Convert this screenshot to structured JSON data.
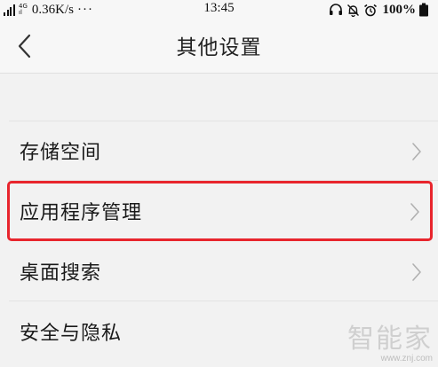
{
  "status_bar": {
    "network_type": "4G",
    "net_badge_bottom": "ıl",
    "speed": "0.36K/s",
    "more": "···",
    "time": "13:45",
    "battery": "100%",
    "icons": [
      "signal-icon",
      "headset-icon",
      "mute-bell-icon",
      "alarm-icon",
      "battery-icon"
    ]
  },
  "header": {
    "title": "其他设置",
    "back_icon": "chevron-left-icon"
  },
  "list": {
    "items": [
      {
        "label": "存储空间",
        "highlighted": false
      },
      {
        "label": "应用程序管理",
        "highlighted": true
      },
      {
        "label": "桌面搜索",
        "highlighted": false
      },
      {
        "label": "安全与隐私",
        "highlighted": false
      }
    ],
    "chevron_icon": "chevron-right-icon"
  },
  "watermark": {
    "text": "智能家",
    "url": "www.znj.com"
  },
  "colors": {
    "background": "#f2f2f2",
    "highlight_border": "#e8252d",
    "text": "#1a1a1a",
    "chevron": "#b0b0b0"
  }
}
